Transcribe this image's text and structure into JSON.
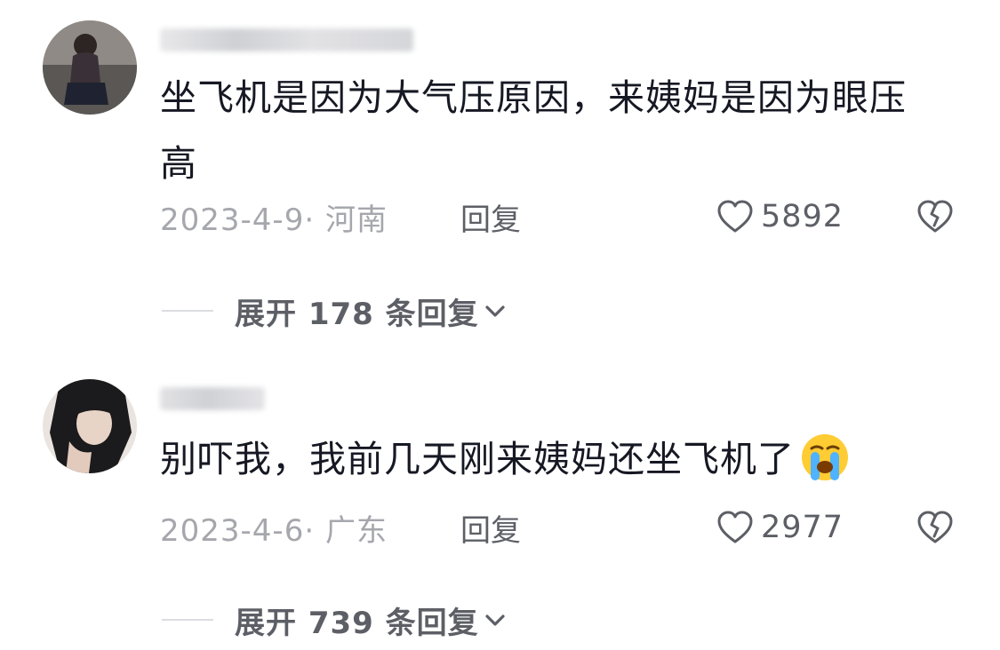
{
  "comments": [
    {
      "text": "坐飞机是因为大气压原因，来姨妈是因为眼压高",
      "date": "2023-4-9",
      "location": "河南",
      "reply_label": "回复",
      "likes": "5892",
      "expand_label": "展开 178 条回复"
    },
    {
      "text": "别吓我，我前几天刚来姨妈还坐飞机了",
      "emoji": "loudly-crying-face",
      "date": "2023-4-6",
      "location": "广东",
      "reply_label": "回复",
      "likes": "2977",
      "expand_label": "展开 739 条回复"
    }
  ],
  "meta_separator": "·",
  "colors": {
    "text_primary": "#161823",
    "text_secondary": "#a6a7ad",
    "action": "#5d5f66",
    "divider": "#dcdde0"
  }
}
